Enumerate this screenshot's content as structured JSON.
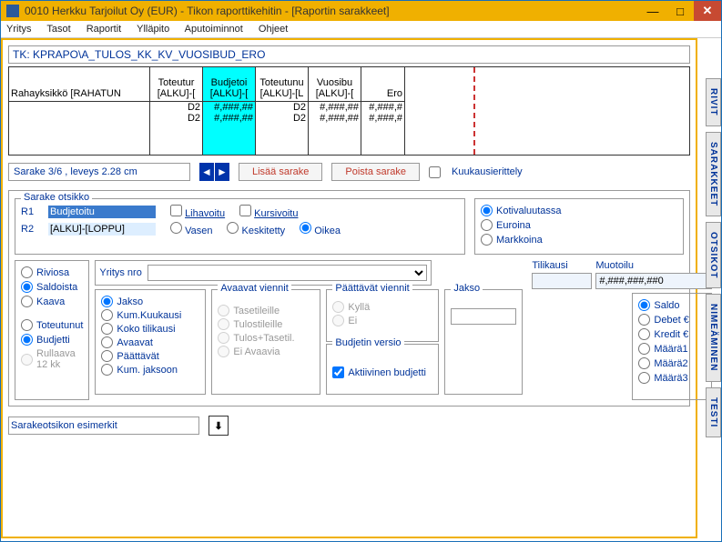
{
  "titlebar": {
    "title": "0010  Herkku Tarjoilut Oy (EUR) - Tikon raporttikehitin - [Raportin sarakkeet]"
  },
  "menu": {
    "yritys": "Yritys",
    "tasot": "Tasot",
    "raportit": "Raportit",
    "yllapito": "Ylläpito",
    "aputoiminnot": "Aputoiminnot",
    "ohjeet": "Ohjeet"
  },
  "tk_path": "TK: KPRAPO\\A_TULOS_KK_KV_VUOSIBUD_ERO",
  "grid": {
    "col0_hdr": "Rahayksikkö [RAHATUN",
    "col1_hdr1": "Toteutur",
    "col1_hdr2": "[ALKU]-[",
    "col1_r1": "D2",
    "col1_r2": "D2",
    "col2_hdr1": "Budjetoi",
    "col2_hdr2": "[ALKU]-[",
    "col2_r1": "#,###,##",
    "col2_r2": "#,###,##",
    "col3_hdr1": "Toteutunu",
    "col3_hdr2": "[ALKU]-[L",
    "col3_r1": "D2",
    "col3_r2": "D2",
    "col4_hdr1": "Vuosibu",
    "col4_hdr2": "[ALKU]-[",
    "col4_r1": "#,###,##",
    "col4_r2": "#,###,##",
    "col5_hdr1": "",
    "col5_hdr2": "Ero",
    "col5_r1": "#,###,#",
    "col5_r2": "#,###,#"
  },
  "status": "Sarake 3/6 , leveys  2.28 cm",
  "buttons": {
    "lisaa": "Lisää sarake",
    "poista": "Poista sarake"
  },
  "kk_erittely": "Kuukausierittely",
  "otsikko": {
    "title": "Sarake otsikko",
    "r1_lbl": "R1",
    "r1_val": "Budjetoitu",
    "r2_lbl": "R2",
    "r2_val": "[ALKU]-[LOPPU]",
    "liha": "Lihavoitu",
    "kursi": "Kursivoitu",
    "vasen": "Vasen",
    "keski": "Keskitetty",
    "oikea": "Oikea"
  },
  "currency": {
    "koti": "Kotivaluutassa",
    "euro": "Euroina",
    "mark": "Markkoina"
  },
  "part": {
    "rivi": "Riviosa",
    "saldo": "Saldoista",
    "kaava": "Kaava"
  },
  "plan": {
    "tot": "Toteutunut",
    "budj": "Budjetti",
    "rull": "Rullaava 12 kk"
  },
  "yritys_lbl": "Yritys nro",
  "jakso_grp": {
    "jakso": "Jakso",
    "kumkk": "Kum.Kuukausi",
    "koko": "Koko tilikausi",
    "avaa": "Avaavat",
    "paat": "Päättävät",
    "kumj": "Kum. jaksoon"
  },
  "avaavat": {
    "title": "Avaavat viennit",
    "tase": "Tasetileille",
    "tulos": "Tulostileille",
    "tt": "Tulos+Tasetil.",
    "ei": "Ei Avaavia"
  },
  "paattavat": {
    "title": "Päättävät viennit",
    "kylla": "Kyllä",
    "ei": "Ei"
  },
  "budjver": {
    "title": "Budjetin versio",
    "aktiiv": "Aktiivinen budjetti"
  },
  "jakso_lbl": "Jakso",
  "tilikausi_lbl": "Tilikausi",
  "muotoilu_lbl": "Muotoilu",
  "muotoilu_val": "#,###,###,##0",
  "saldo_grp": {
    "saldo": "Saldo",
    "debet": "Debet €",
    "kredit": "Kredit €",
    "m1": "Määrä1",
    "m2": "Määrä2",
    "m3": "Määrä3"
  },
  "example": "Sarakeotsikon esimerkit",
  "tabs": {
    "rivit": "RIVIT",
    "sarak": "SARAKKEET",
    "otsik": "OTSIKOT",
    "nime": "NIMEÄMINEN",
    "testi": "TESTI"
  }
}
